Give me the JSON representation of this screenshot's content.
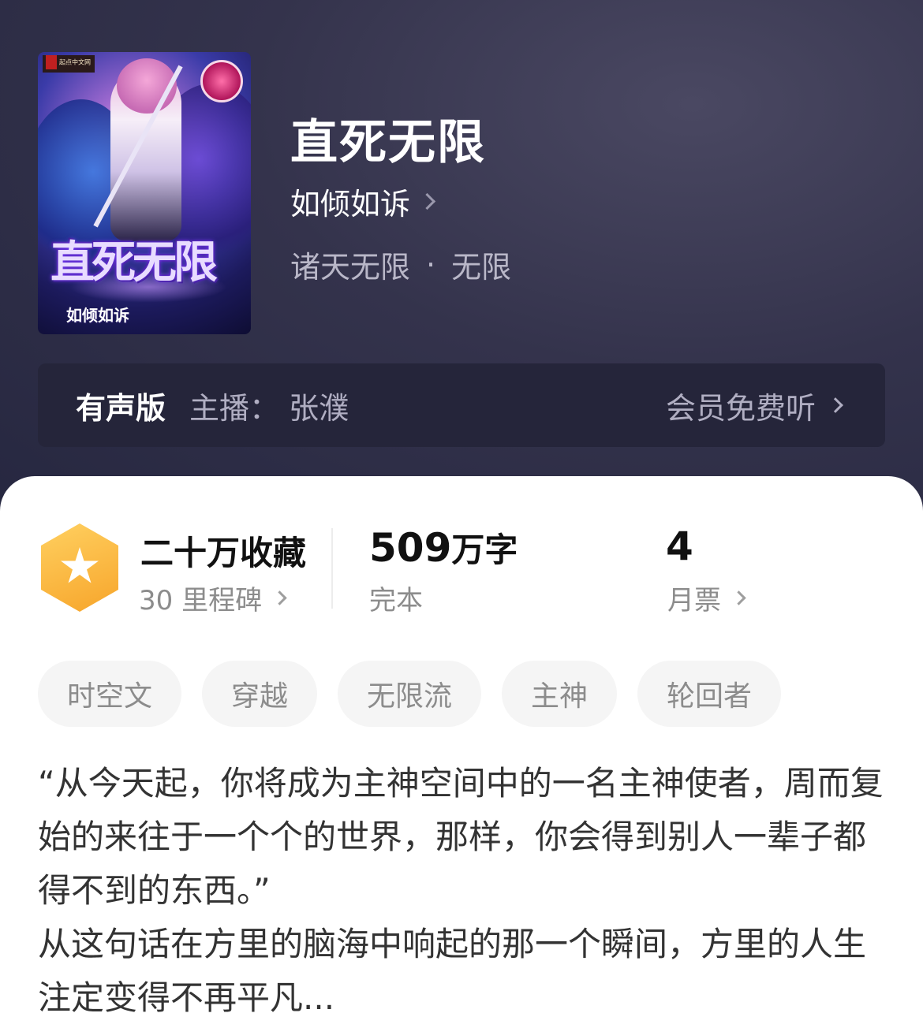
{
  "book": {
    "title": "直死无限",
    "author": "如倾如诉",
    "category": "诸天无限",
    "subcategory": "无限",
    "cover": {
      "title_art": "直死无限",
      "author_art": "如倾如诉",
      "publisher_logo": "起点中文网"
    }
  },
  "audio": {
    "version_label": "有声版",
    "host_label": "主播：",
    "host_name": "张濮",
    "cta": "会员免费听"
  },
  "stats": {
    "collection": {
      "value": "二十万收藏",
      "sub": "30 里程碑"
    },
    "words": {
      "number": "509",
      "unit": "万字",
      "sub": "完本"
    },
    "tickets": {
      "value": "4",
      "sub": "月票"
    }
  },
  "tags": [
    "时空文",
    "穿越",
    "无限流",
    "主神",
    "轮回者"
  ],
  "description": {
    "para1": "“从今天起，你将成为主神空间中的一名主神使者，周而复始的来往于一个个的世界，那样，你会得到别人一辈子都得不到的东西。”",
    "para2": "从这句话在方里的脑海中响起的那一个瞬间，方里的人生注定变得不再平凡..."
  },
  "colors": {
    "hero_bg": "#2f2e46",
    "audio_bar_bg": "#25253a",
    "badge_gold": "#f7a52b",
    "tag_bg": "#f5f5f5"
  }
}
